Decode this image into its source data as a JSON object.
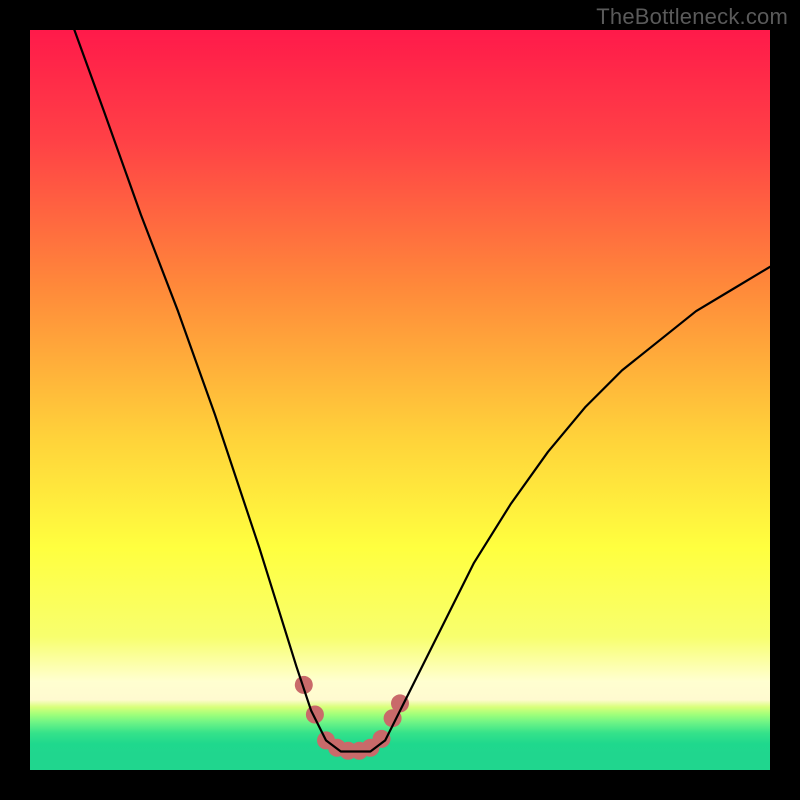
{
  "watermark": "TheBottleneck.com",
  "chart_data": {
    "type": "line",
    "title": "",
    "xlabel": "",
    "ylabel": "",
    "xlim": [
      0,
      100
    ],
    "ylim": [
      0,
      100
    ],
    "series": [
      {
        "name": "bottleneck-curve",
        "x": [
          6,
          10,
          15,
          20,
          25,
          28,
          31,
          33.5,
          36,
          38,
          40,
          42,
          44,
          46,
          48,
          50,
          55,
          60,
          65,
          70,
          75,
          80,
          85,
          90,
          95,
          100
        ],
        "values": [
          100,
          89,
          75,
          62,
          48,
          39,
          30,
          22,
          14,
          8,
          4,
          2.5,
          2.5,
          2.5,
          4,
          8,
          18,
          28,
          36,
          43,
          49,
          54,
          58,
          62,
          65,
          68
        ]
      }
    ],
    "markers": {
      "name": "bottom-markers",
      "color": "#c96a6a",
      "points": [
        {
          "x": 37.0,
          "y": 11.5
        },
        {
          "x": 38.5,
          "y": 7.5
        },
        {
          "x": 40.0,
          "y": 4.0
        },
        {
          "x": 41.5,
          "y": 3.0
        },
        {
          "x": 43.0,
          "y": 2.6
        },
        {
          "x": 44.5,
          "y": 2.6
        },
        {
          "x": 46.0,
          "y": 3.0
        },
        {
          "x": 47.5,
          "y": 4.2
        },
        {
          "x": 49.0,
          "y": 7.0
        },
        {
          "x": 50.0,
          "y": 9.0
        }
      ]
    },
    "background": {
      "stops": [
        {
          "pos": 0.0,
          "color": "#ff1a4a"
        },
        {
          "pos": 0.15,
          "color": "#ff4146"
        },
        {
          "pos": 0.35,
          "color": "#ff8a3a"
        },
        {
          "pos": 0.55,
          "color": "#ffd23a"
        },
        {
          "pos": 0.7,
          "color": "#ffff3f"
        },
        {
          "pos": 0.82,
          "color": "#f8ff6e"
        },
        {
          "pos": 0.88,
          "color": "#ffffd0"
        },
        {
          "pos": 0.905,
          "color": "#fffad0"
        },
        {
          "pos": 0.915,
          "color": "#d8ff7a"
        },
        {
          "pos": 0.925,
          "color": "#a0ff7a"
        },
        {
          "pos": 0.935,
          "color": "#70f585"
        },
        {
          "pos": 0.95,
          "color": "#35e28a"
        },
        {
          "pos": 0.965,
          "color": "#1fd88d"
        },
        {
          "pos": 0.98,
          "color": "#20d68e"
        },
        {
          "pos": 1.0,
          "color": "#20d68e"
        }
      ]
    }
  }
}
